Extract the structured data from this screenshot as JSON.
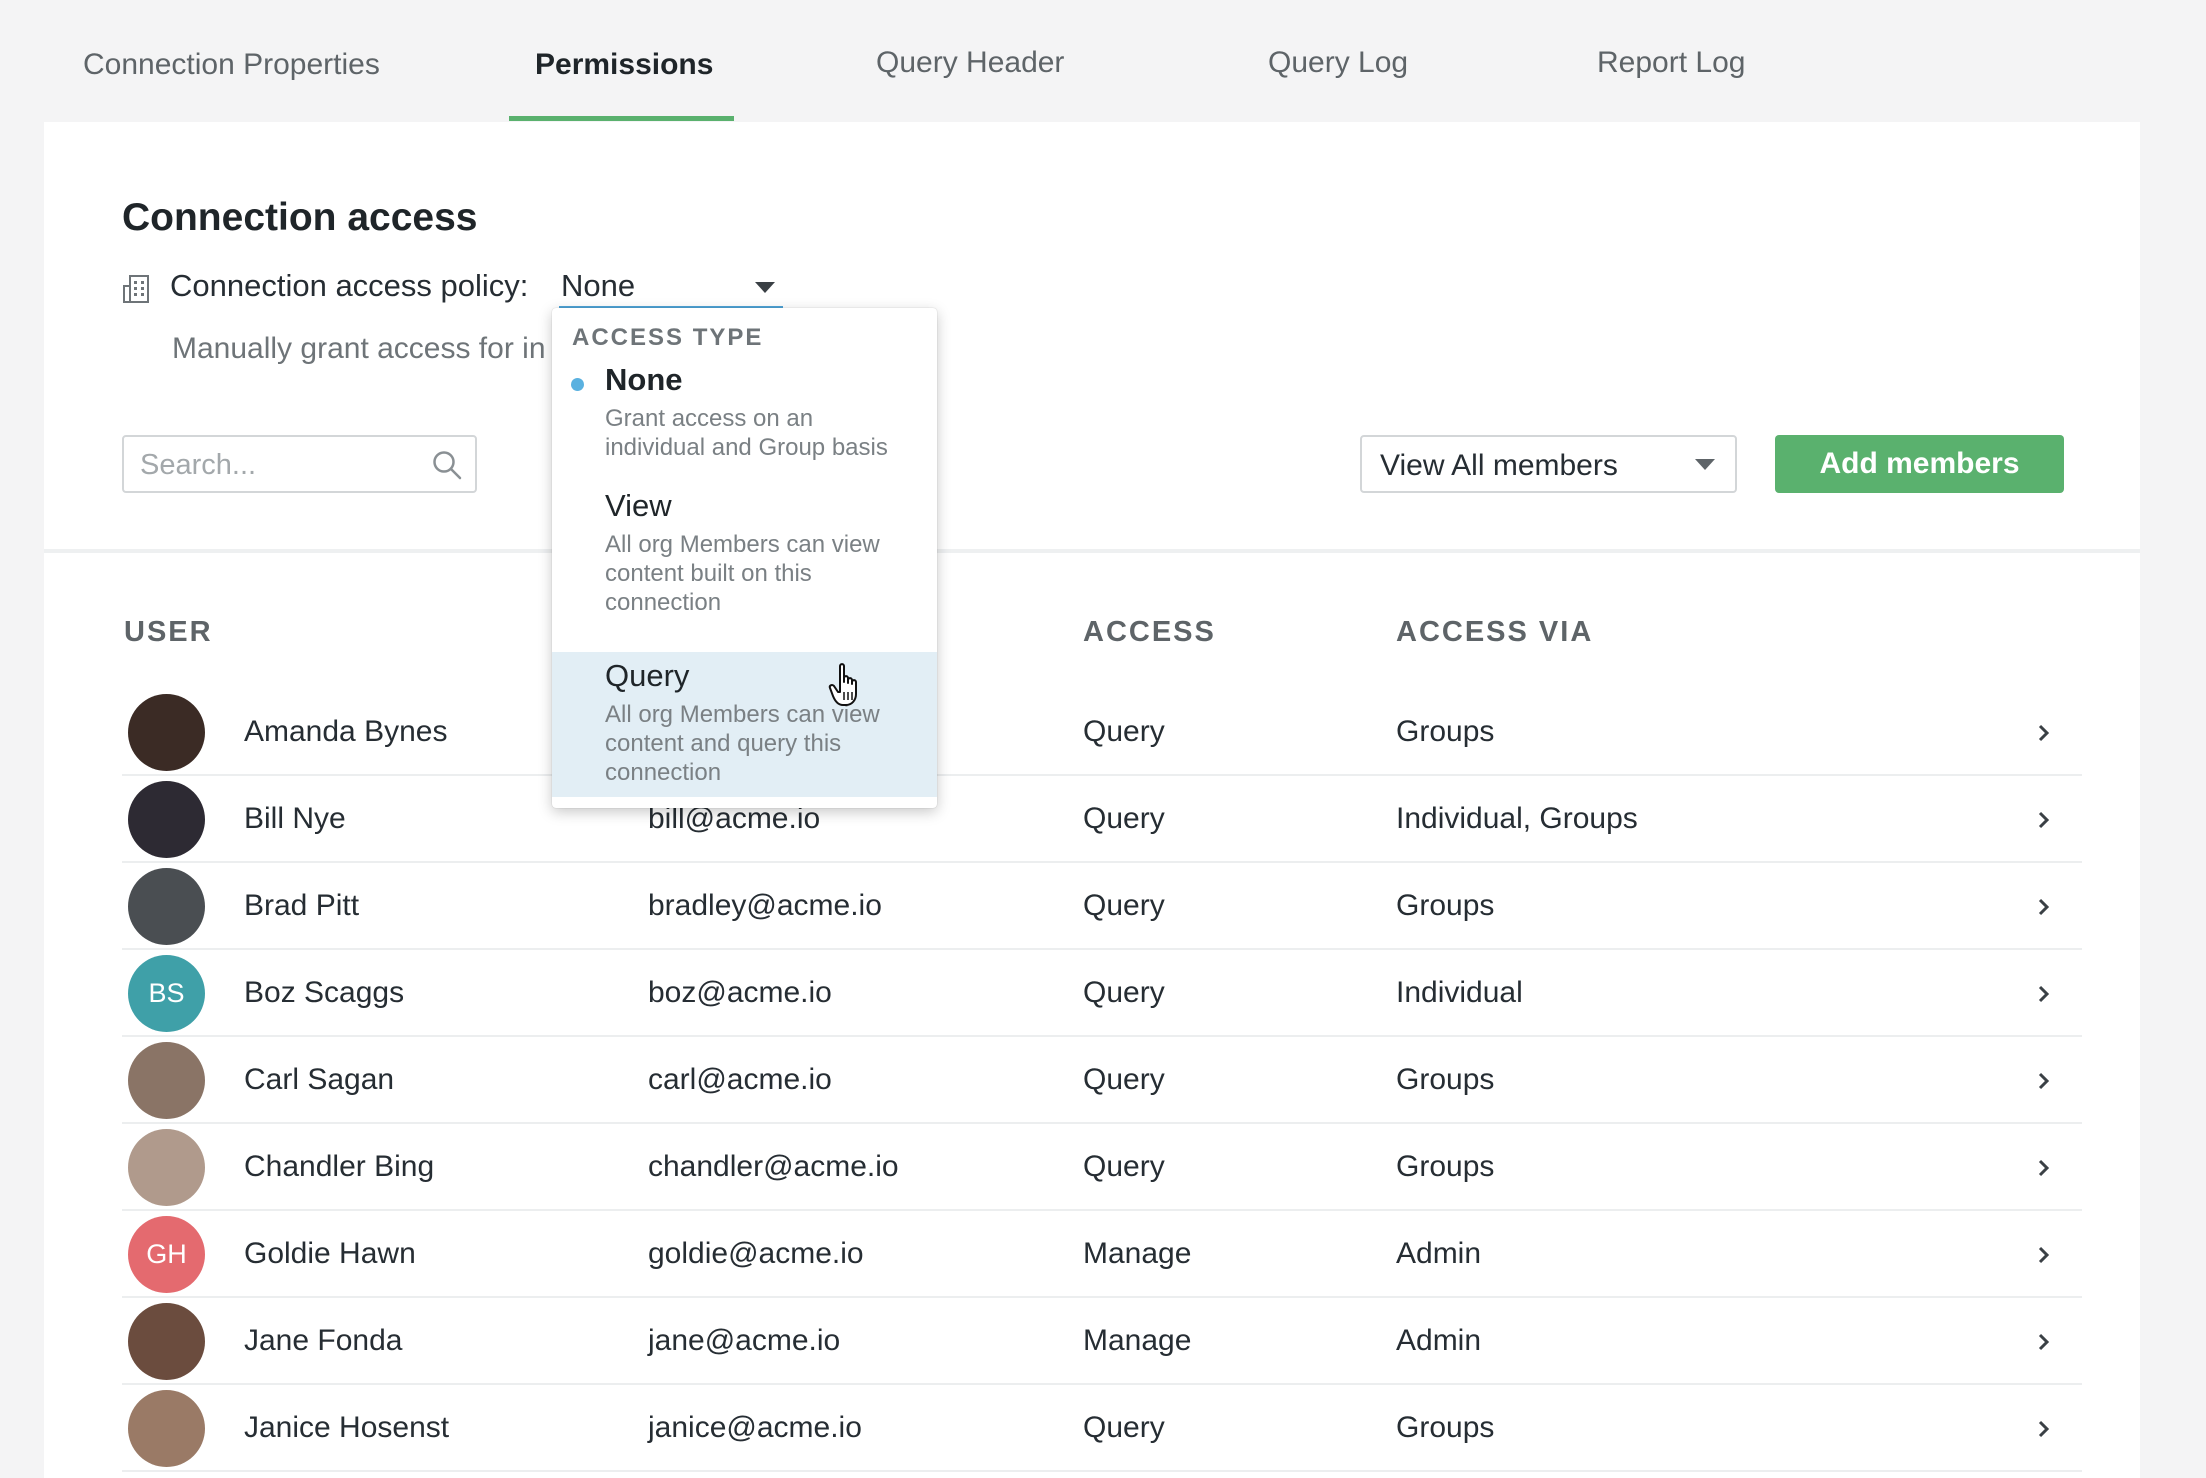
{
  "tabs": [
    {
      "label": "Connection Properties"
    },
    {
      "label": "Permissions"
    },
    {
      "label": "Query Header"
    },
    {
      "label": "Query Log"
    },
    {
      "label": "Report Log"
    }
  ],
  "active_tab": "Permissions",
  "section": {
    "title": "Connection access",
    "policy_label": "Connection access policy:",
    "policy_value": "None",
    "manual_text": "Manually grant access for in"
  },
  "search": {
    "placeholder": "Search..."
  },
  "view_filter": {
    "value": "View All members"
  },
  "add_button": {
    "label": "Add members"
  },
  "table": {
    "headers": {
      "user": "USER",
      "access": "ACCESS",
      "access_via": "ACCESS VIA"
    },
    "rows": [
      {
        "name": "Amanda Bynes",
        "email": "",
        "access": "Query",
        "via": "Groups",
        "initials": "",
        "avatar_color": "#3b2b25"
      },
      {
        "name": "Bill Nye",
        "email": "bill@acme.io",
        "access": "Query",
        "via": "Individual, Groups",
        "initials": "",
        "avatar_color": "#2d2a33"
      },
      {
        "name": "Brad Pitt",
        "email": "bradley@acme.io",
        "access": "Query",
        "via": "Groups",
        "initials": "",
        "avatar_color": "#4a4e52"
      },
      {
        "name": "Boz Scaggs",
        "email": "boz@acme.io",
        "access": "Query",
        "via": "Individual",
        "initials": "BS",
        "avatar_color": "#3fa0a8"
      },
      {
        "name": "Carl Sagan",
        "email": "carl@acme.io",
        "access": "Query",
        "via": "Groups",
        "initials": "",
        "avatar_color": "#8a7466"
      },
      {
        "name": "Chandler Bing",
        "email": "chandler@acme.io",
        "access": "Query",
        "via": "Groups",
        "initials": "",
        "avatar_color": "#b09a8c"
      },
      {
        "name": "Goldie Hawn",
        "email": "goldie@acme.io",
        "access": "Manage",
        "via": "Admin",
        "initials": "GH",
        "avatar_color": "#e46a6f"
      },
      {
        "name": "Jane Fonda",
        "email": "jane@acme.io",
        "access": "Manage",
        "via": "Admin",
        "initials": "",
        "avatar_color": "#6b4c3e"
      },
      {
        "name": "Janice Hosenst",
        "email": "janice@acme.io",
        "access": "Query",
        "via": "Groups",
        "initials": "",
        "avatar_color": "#9a7a66"
      }
    ]
  },
  "dropdown": {
    "header": "ACCESS TYPE",
    "options": [
      {
        "title": "None",
        "desc": "Grant access on an individual and Group basis",
        "selected": true
      },
      {
        "title": "View",
        "desc": "All org Members can view content built on this connection",
        "selected": false
      },
      {
        "title": "Query",
        "desc": "All org Members can view content and query this connection",
        "selected": false,
        "hovered": true
      }
    ]
  },
  "colors": {
    "accent_green": "#5ab16e",
    "accent_blue": "#4fa3d6",
    "hover_bg": "#e2eef5"
  },
  "icons": {
    "policy": "building-icon",
    "search": "search-icon",
    "row_action": "chevron-right-icon",
    "pointer": "hand-cursor-icon"
  }
}
